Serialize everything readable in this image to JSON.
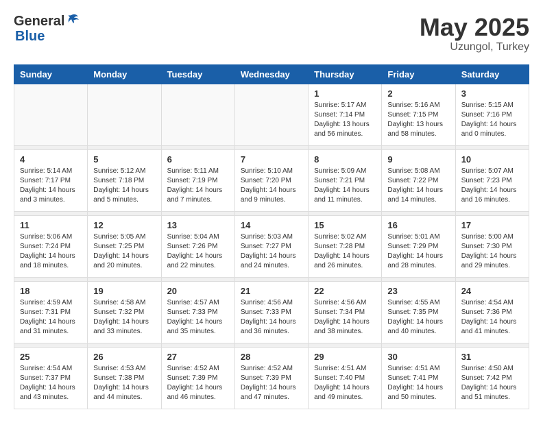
{
  "logo": {
    "general": "General",
    "blue": "Blue"
  },
  "title": {
    "month": "May 2025",
    "location": "Uzungol, Turkey"
  },
  "weekdays": [
    "Sunday",
    "Monday",
    "Tuesday",
    "Wednesday",
    "Thursday",
    "Friday",
    "Saturday"
  ],
  "weeks": [
    [
      {
        "day": "",
        "info": ""
      },
      {
        "day": "",
        "info": ""
      },
      {
        "day": "",
        "info": ""
      },
      {
        "day": "",
        "info": ""
      },
      {
        "day": "1",
        "info": "Sunrise: 5:17 AM\nSunset: 7:14 PM\nDaylight: 13 hours and 56 minutes."
      },
      {
        "day": "2",
        "info": "Sunrise: 5:16 AM\nSunset: 7:15 PM\nDaylight: 13 hours and 58 minutes."
      },
      {
        "day": "3",
        "info": "Sunrise: 5:15 AM\nSunset: 7:16 PM\nDaylight: 14 hours and 0 minutes."
      }
    ],
    [
      {
        "day": "4",
        "info": "Sunrise: 5:14 AM\nSunset: 7:17 PM\nDaylight: 14 hours and 3 minutes."
      },
      {
        "day": "5",
        "info": "Sunrise: 5:12 AM\nSunset: 7:18 PM\nDaylight: 14 hours and 5 minutes."
      },
      {
        "day": "6",
        "info": "Sunrise: 5:11 AM\nSunset: 7:19 PM\nDaylight: 14 hours and 7 minutes."
      },
      {
        "day": "7",
        "info": "Sunrise: 5:10 AM\nSunset: 7:20 PM\nDaylight: 14 hours and 9 minutes."
      },
      {
        "day": "8",
        "info": "Sunrise: 5:09 AM\nSunset: 7:21 PM\nDaylight: 14 hours and 11 minutes."
      },
      {
        "day": "9",
        "info": "Sunrise: 5:08 AM\nSunset: 7:22 PM\nDaylight: 14 hours and 14 minutes."
      },
      {
        "day": "10",
        "info": "Sunrise: 5:07 AM\nSunset: 7:23 PM\nDaylight: 14 hours and 16 minutes."
      }
    ],
    [
      {
        "day": "11",
        "info": "Sunrise: 5:06 AM\nSunset: 7:24 PM\nDaylight: 14 hours and 18 minutes."
      },
      {
        "day": "12",
        "info": "Sunrise: 5:05 AM\nSunset: 7:25 PM\nDaylight: 14 hours and 20 minutes."
      },
      {
        "day": "13",
        "info": "Sunrise: 5:04 AM\nSunset: 7:26 PM\nDaylight: 14 hours and 22 minutes."
      },
      {
        "day": "14",
        "info": "Sunrise: 5:03 AM\nSunset: 7:27 PM\nDaylight: 14 hours and 24 minutes."
      },
      {
        "day": "15",
        "info": "Sunrise: 5:02 AM\nSunset: 7:28 PM\nDaylight: 14 hours and 26 minutes."
      },
      {
        "day": "16",
        "info": "Sunrise: 5:01 AM\nSunset: 7:29 PM\nDaylight: 14 hours and 28 minutes."
      },
      {
        "day": "17",
        "info": "Sunrise: 5:00 AM\nSunset: 7:30 PM\nDaylight: 14 hours and 29 minutes."
      }
    ],
    [
      {
        "day": "18",
        "info": "Sunrise: 4:59 AM\nSunset: 7:31 PM\nDaylight: 14 hours and 31 minutes."
      },
      {
        "day": "19",
        "info": "Sunrise: 4:58 AM\nSunset: 7:32 PM\nDaylight: 14 hours and 33 minutes."
      },
      {
        "day": "20",
        "info": "Sunrise: 4:57 AM\nSunset: 7:33 PM\nDaylight: 14 hours and 35 minutes."
      },
      {
        "day": "21",
        "info": "Sunrise: 4:56 AM\nSunset: 7:33 PM\nDaylight: 14 hours and 36 minutes."
      },
      {
        "day": "22",
        "info": "Sunrise: 4:56 AM\nSunset: 7:34 PM\nDaylight: 14 hours and 38 minutes."
      },
      {
        "day": "23",
        "info": "Sunrise: 4:55 AM\nSunset: 7:35 PM\nDaylight: 14 hours and 40 minutes."
      },
      {
        "day": "24",
        "info": "Sunrise: 4:54 AM\nSunset: 7:36 PM\nDaylight: 14 hours and 41 minutes."
      }
    ],
    [
      {
        "day": "25",
        "info": "Sunrise: 4:54 AM\nSunset: 7:37 PM\nDaylight: 14 hours and 43 minutes."
      },
      {
        "day": "26",
        "info": "Sunrise: 4:53 AM\nSunset: 7:38 PM\nDaylight: 14 hours and 44 minutes."
      },
      {
        "day": "27",
        "info": "Sunrise: 4:52 AM\nSunset: 7:39 PM\nDaylight: 14 hours and 46 minutes."
      },
      {
        "day": "28",
        "info": "Sunrise: 4:52 AM\nSunset: 7:39 PM\nDaylight: 14 hours and 47 minutes."
      },
      {
        "day": "29",
        "info": "Sunrise: 4:51 AM\nSunset: 7:40 PM\nDaylight: 14 hours and 49 minutes."
      },
      {
        "day": "30",
        "info": "Sunrise: 4:51 AM\nSunset: 7:41 PM\nDaylight: 14 hours and 50 minutes."
      },
      {
        "day": "31",
        "info": "Sunrise: 4:50 AM\nSunset: 7:42 PM\nDaylight: 14 hours and 51 minutes."
      }
    ]
  ]
}
